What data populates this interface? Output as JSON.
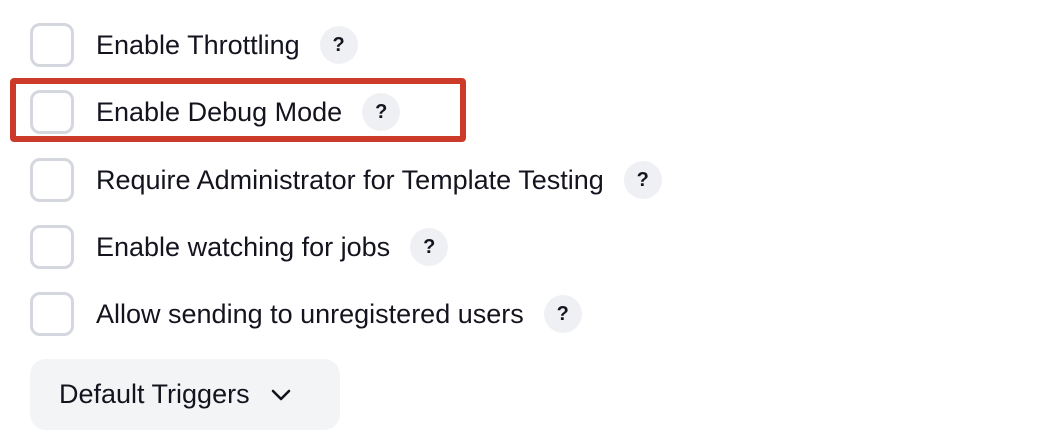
{
  "options": [
    {
      "label": "Enable Throttling",
      "checked": false,
      "help": "?"
    },
    {
      "label": "Enable Debug Mode",
      "checked": false,
      "help": "?",
      "highlighted": true
    },
    {
      "label": "Require Administrator for Template Testing",
      "checked": false,
      "help": "?"
    },
    {
      "label": "Enable watching for jobs",
      "checked": false,
      "help": "?"
    },
    {
      "label": "Allow sending to unregistered users",
      "checked": false,
      "help": "?"
    }
  ],
  "triggers": {
    "label": "Default Triggers",
    "icon": "chevron-down-icon"
  },
  "colors": {
    "highlight": "#cc3a2a",
    "checkbox_border": "#d4d7de",
    "help_bg": "#eff0f3",
    "button_bg": "#f3f4f6"
  }
}
